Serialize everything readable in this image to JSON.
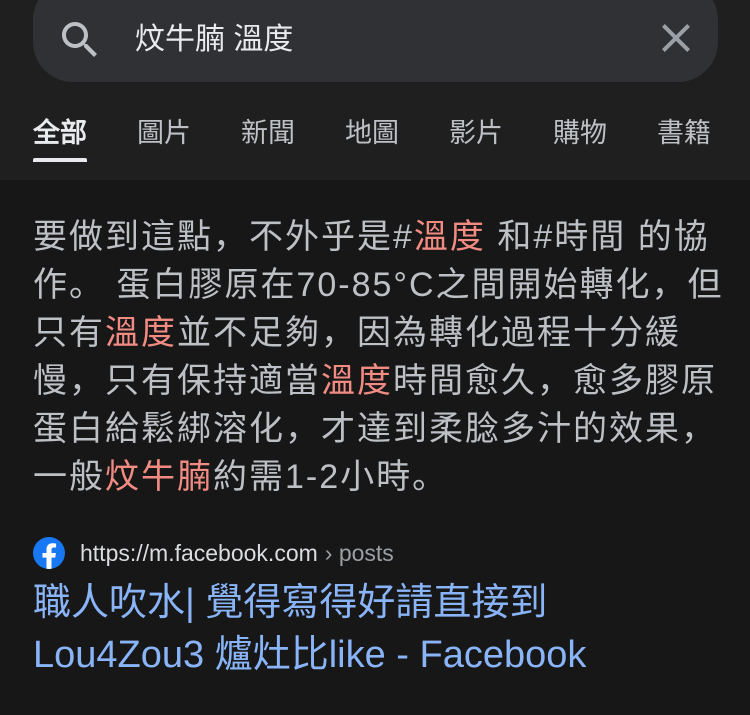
{
  "search": {
    "query": "炆牛腩 溫度",
    "search_icon": "search-icon",
    "clear_icon": "close-icon"
  },
  "tabs": [
    {
      "label": "全部",
      "active": true
    },
    {
      "label": "圖片"
    },
    {
      "label": "新聞"
    },
    {
      "label": "地圖"
    },
    {
      "label": "影片"
    },
    {
      "label": "購物"
    },
    {
      "label": "書籍"
    }
  ],
  "snippet": {
    "lines": [
      {
        "segments": [
          {
            "text": "要做到這點，不外乎是#"
          },
          {
            "text": "溫度",
            "highlight": true
          },
          {
            "text": " 和#時間 的協"
          }
        ]
      },
      {
        "segments": [
          {
            "text": "作。 蛋白膠原在70-85°C之間開始轉化，但"
          }
        ]
      },
      {
        "segments": [
          {
            "text": "只有"
          },
          {
            "text": "溫度",
            "highlight": true
          },
          {
            "text": "並不足夠，因為轉化過程十分緩"
          }
        ]
      },
      {
        "segments": [
          {
            "text": "慢，只有保持適當"
          },
          {
            "text": "溫度",
            "highlight": true
          },
          {
            "text": "時間愈久，愈多膠原"
          }
        ]
      },
      {
        "segments": [
          {
            "text": "蛋白給鬆綁溶化，才達到柔腍多汁的效果，"
          }
        ]
      },
      {
        "segments": [
          {
            "text": "一般"
          },
          {
            "text": "炆牛腩",
            "highlight": true
          },
          {
            "text": "約需1-2小時。"
          }
        ]
      }
    ]
  },
  "result": {
    "favicon": "facebook-icon",
    "url": "https://m.facebook.com",
    "breadcrumb": "› posts",
    "title_lines": [
      "職人吹水| 覺得寫得好請直接到",
      "Lou4Zou3 爐灶比like - Facebook"
    ]
  },
  "colors": {
    "background": "#171717",
    "header": "#1f1f1f",
    "search_box": "#303134",
    "text": "#bdc1c6",
    "highlight": "#f28b82",
    "link": "#8ab4f8",
    "facebook_blue": "#1877f2"
  }
}
